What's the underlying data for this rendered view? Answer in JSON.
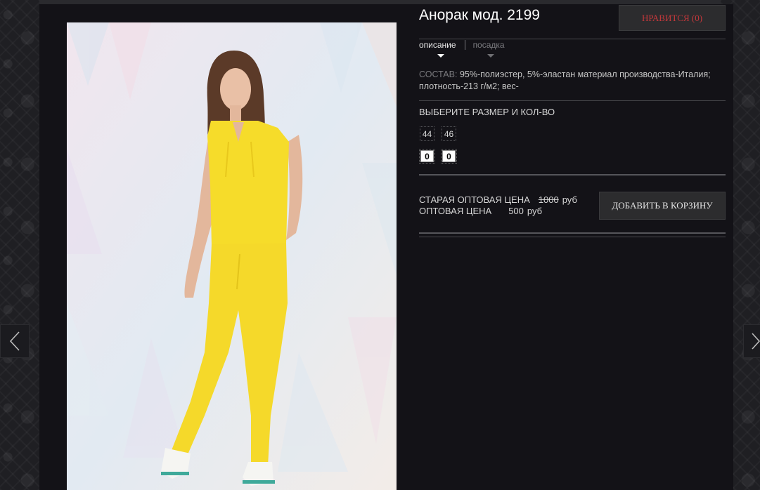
{
  "product": {
    "title": "Анорак мод. 2199",
    "like_label": "НРАВИТСЯ (0)"
  },
  "tabs": [
    {
      "label": "описание",
      "active": true
    },
    {
      "label": "посадка",
      "active": false
    }
  ],
  "composition": {
    "label": "СОСТАВ:",
    "text": "95%-полиэстер, 5%-эластан материал производства-Италия; плотность-213 г/м2; вес-"
  },
  "sizes": {
    "heading": "ВЫБЕРИТЕ РАЗМЕР И КОЛ-ВО",
    "options": [
      {
        "size": "44",
        "qty": "0"
      },
      {
        "size": "46",
        "qty": "0"
      }
    ]
  },
  "pricing": {
    "old_label": "СТАРАЯ ОПТОВАЯ ЦЕНА",
    "old_value": "1000",
    "current_label": "ОПТОВАЯ ЦЕНА",
    "current_value": "500",
    "currency": "руб"
  },
  "cart": {
    "button_label": "ДОБАВИТЬ В КОРЗИНУ"
  },
  "icons": {
    "prev": "chevron-left-icon",
    "next": "chevron-right-icon"
  },
  "colors": {
    "background": "#131217",
    "like_text": "#c4383b",
    "garment": "#f6dc2a"
  }
}
